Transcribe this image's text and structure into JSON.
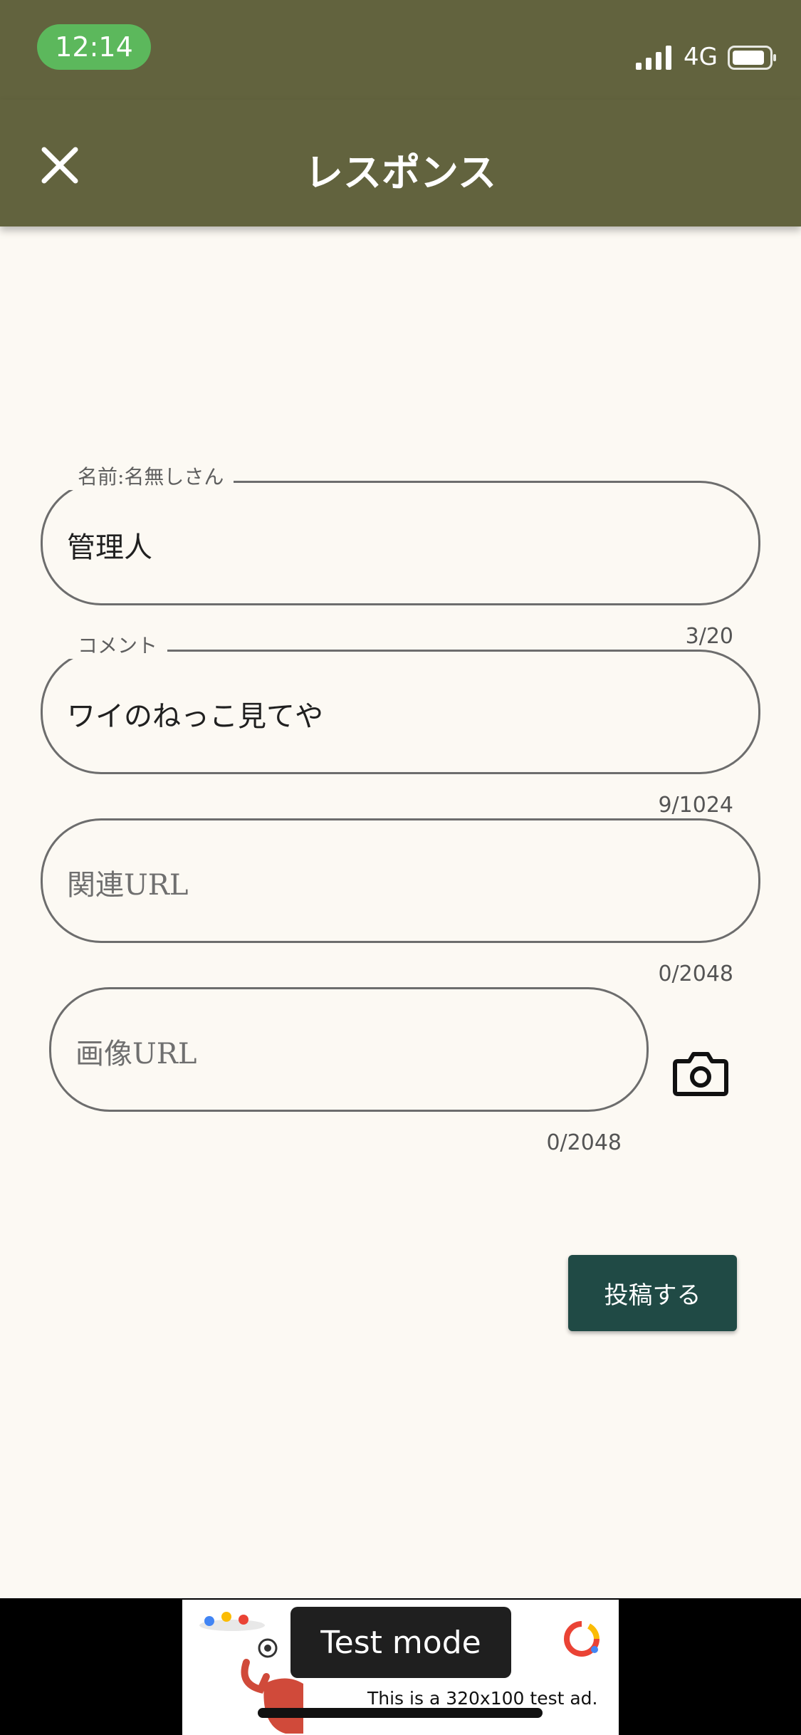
{
  "status_bar": {
    "time": "12:14",
    "network": "4G"
  },
  "header": {
    "title": "レスポンス",
    "close_icon": "close-icon"
  },
  "form": {
    "name": {
      "label": "名前:名無しさん",
      "value": "管理人",
      "counter": "3/20"
    },
    "comment": {
      "label": "コメント",
      "value": "ワイのねっこ見てや",
      "counter": "9/1024"
    },
    "related_url": {
      "placeholder": "関連URL",
      "counter": "0/2048"
    },
    "image_url": {
      "placeholder": "画像URL",
      "counter": "0/2048",
      "camera_icon": "camera-icon"
    }
  },
  "actions": {
    "post_label": "投稿する"
  },
  "ad": {
    "badge": "Test mode",
    "text": "This is a 320x100 test ad."
  },
  "colors": {
    "header_bg": "#62633e",
    "background": "#fcf9f3",
    "primary_button": "#204a45",
    "time_pill": "#5cb85c"
  }
}
